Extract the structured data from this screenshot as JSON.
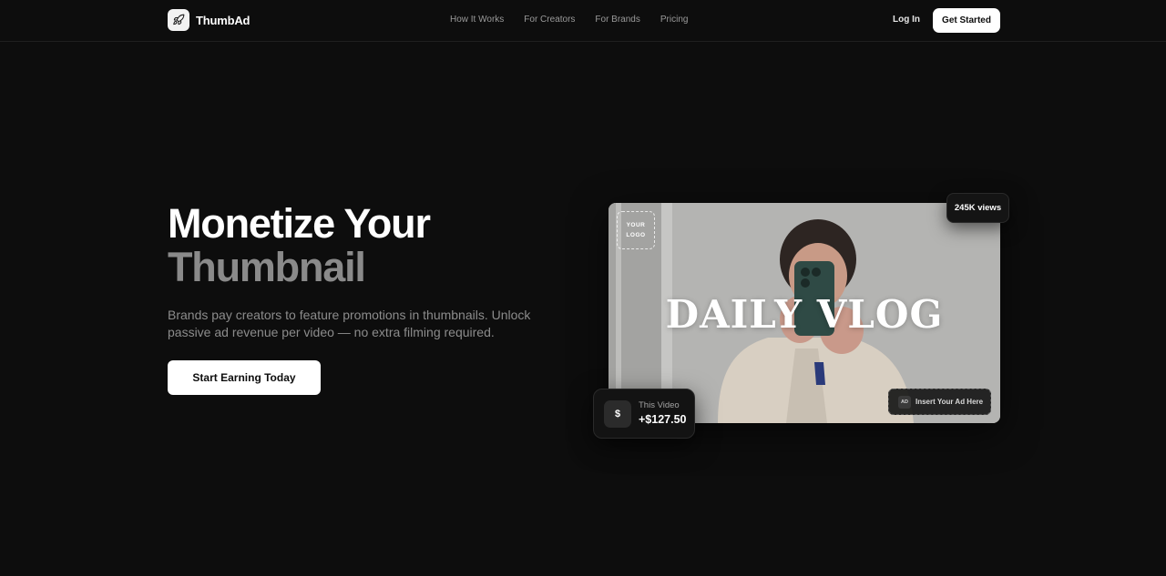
{
  "brand": {
    "name": "ThumbAd",
    "icon": "rocket-icon"
  },
  "nav": {
    "links": [
      {
        "label": "How It Works"
      },
      {
        "label": "For Creators"
      },
      {
        "label": "For Brands"
      },
      {
        "label": "Pricing"
      }
    ],
    "login_label": "Log In",
    "cta_label": "Get Started"
  },
  "hero": {
    "title_line1": "Monetize Your",
    "title_line2": "Thumbnail",
    "subtitle": "Brands pay creators to feature promotions in thumbnails. Unlock passive ad revenue per video — no extra filming required.",
    "cta_label": "Start Earning Today"
  },
  "preview": {
    "logo_line1": "YOUR",
    "logo_line2": "LOGO",
    "title": "DAILY VLOG",
    "views": "245K views",
    "ad_badge": "AD",
    "ad_label": "Insert Your Ad Here",
    "earn_icon": "$",
    "earn_label": "This Video",
    "earn_value": "+$127.50"
  },
  "colors": {
    "background": "#0d0d0d",
    "accent": "#ffffff",
    "muted_text": "#8c8c8c"
  }
}
